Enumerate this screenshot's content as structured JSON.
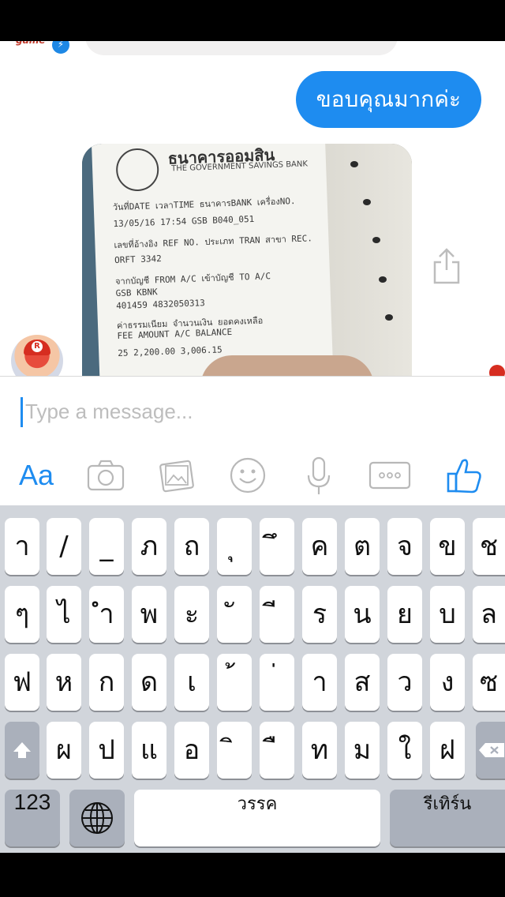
{
  "conversation": {
    "sender_badge_text": "game",
    "outgoing_message": "ขอบคุณมากค่ะ",
    "photo": {
      "bank_name_thai": "ธนาคารออมสิน",
      "bank_name_english": "THE GOVERNMENT SAVINGS BANK",
      "receipt_lines": [
        "วันที่DATE  เวลาTIME ธนาคารBANK เครื่องNO.",
        "13/05/16   17:54   GSB   B040_051",
        "เลขที่อ้างอิง REF NO. ประเภท TRAN สาขา REC.",
        "               ORFT        3342",
        "จากบัญชี FROM A/C    เข้าบัญชี TO A/C",
        "  GSB                KBNK",
        "  401459             4832050313",
        "ค่าธรรมเนียม  จำนวนเงิน   ยอดคงเหลือ",
        "  FEE       AMOUNT     A/C BALANCE",
        "  25       2,200.00       3,006.15"
      ]
    },
    "avatar_letter": "R"
  },
  "composer": {
    "placeholder": "Type a message..."
  },
  "toolbar": {
    "text_style_label": "Aa",
    "icons": [
      "camera-icon",
      "gallery-icon",
      "emoji-icon",
      "microphone-icon",
      "more-icon",
      "thumbs-up-icon"
    ]
  },
  "keyboard": {
    "row1": [
      "า",
      "/",
      "_",
      "ภ",
      "ถ",
      "ุ",
      "ึ",
      "ค",
      "ต",
      "จ",
      "ข",
      "ช"
    ],
    "row2": [
      "ๆ",
      "ไ",
      "ำ",
      "พ",
      "ะ",
      "ั",
      "ี",
      "ร",
      "น",
      "ย",
      "บ",
      "ล"
    ],
    "row3": [
      "ฟ",
      "ห",
      "ก",
      "ด",
      "เ",
      "้",
      "่",
      "า",
      "ส",
      "ว",
      "ง",
      "ซ"
    ],
    "row4": [
      "ผ",
      "ป",
      "แ",
      "อ",
      "ิ",
      "ื",
      "ท",
      "ม",
      "ใ",
      "ฝ"
    ],
    "numbers_label": "123",
    "space_label": "วรรค",
    "return_label": "รีเทิร์น"
  },
  "colors": {
    "accent": "#1e8cf0",
    "keyboard_bg": "#d1d5db",
    "special_key": "#aab0bb"
  }
}
